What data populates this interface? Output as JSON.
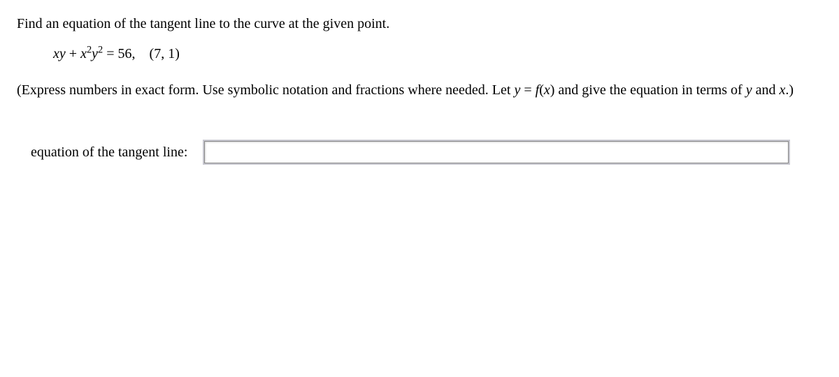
{
  "question": {
    "prompt": "Find an equation of the tangent line to the curve at the given point.",
    "equation_lhs_var1": "x",
    "equation_lhs_var2": "y",
    "equation_plus": " + ",
    "equation_lhs_var3": "x",
    "equation_sup2a": "2",
    "equation_lhs_var4": "y",
    "equation_sup2b": "2",
    "equation_eq": " = ",
    "equation_rhs": "56,",
    "equation_spacer": " ",
    "point": "(7, 1)",
    "instruction_part1": "(Express numbers in exact form. Use symbolic notation and fractions where needed. Let ",
    "instruction_y": "y",
    "instruction_eq": " = ",
    "instruction_fx_f": "f",
    "instruction_fx_open": "(",
    "instruction_fx_x": "x",
    "instruction_fx_close": ")",
    "instruction_part2": " and give the equation in terms of ",
    "instruction_y2": "y",
    "instruction_and": " and ",
    "instruction_x2": "x",
    "instruction_part3": ".)",
    "answer_label": "equation of the tangent line:",
    "answer_value": ""
  }
}
